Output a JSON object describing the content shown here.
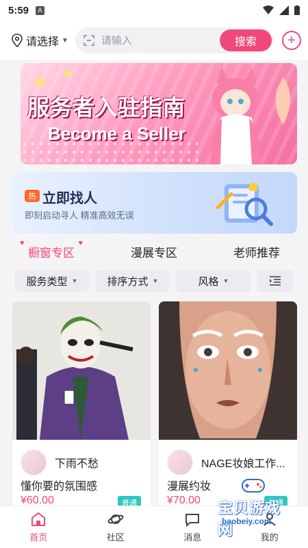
{
  "status_bar": {
    "time": "5:59",
    "badge": "A"
  },
  "header": {
    "location_label": "请选择",
    "search_placeholder": "请输入",
    "search_button": "搜索",
    "add_label": "+"
  },
  "banner": {
    "title": "服务者入驻指南",
    "subtitle": "Become a Seller"
  },
  "promo": {
    "hot_badge": "热",
    "title": "立即找人",
    "description": "即刻启动寻人 精准高效无误"
  },
  "tabs": [
    {
      "label": "橱窗专区",
      "active": true
    },
    {
      "label": "漫展专区",
      "active": false
    },
    {
      "label": "老师推荐",
      "active": false
    }
  ],
  "filters": [
    {
      "label": "服务类型"
    },
    {
      "label": "排序方式"
    },
    {
      "label": "风格"
    }
  ],
  "cards": [
    {
      "username": "下雨不愁",
      "service": "懂你要的氛围感",
      "price": "¥60.00",
      "badge": "普通"
    },
    {
      "username": "NAGE妆娘工作...",
      "service": "漫展约妆",
      "price": "¥70.00",
      "badge": "普通"
    }
  ],
  "bottom_nav": [
    {
      "label": "首页",
      "icon": "home-icon",
      "active": true
    },
    {
      "label": "社区",
      "icon": "planet-icon",
      "active": false
    },
    {
      "label": "消息",
      "icon": "message-icon",
      "active": false
    },
    {
      "label": "我的",
      "icon": "profile-icon",
      "active": false
    }
  ],
  "watermark": {
    "text": "宝贝游戏网",
    "url": "baobeiy.com"
  },
  "colors": {
    "accent": "#f0487a",
    "badge": "#2ec8c0",
    "promo_bg": "#cfe0fb"
  }
}
